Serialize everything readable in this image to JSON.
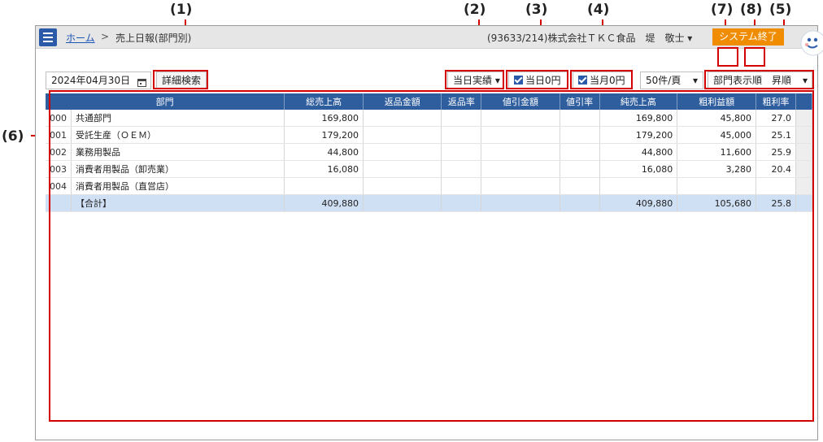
{
  "callouts": {
    "c1": "(1)",
    "c2": "(2)",
    "c3": "(3)",
    "c4": "(4)",
    "c7": "(7)",
    "c8": "(8)",
    "c5": "(5)",
    "c6": "(6)"
  },
  "header": {
    "home_link": "ホーム",
    "separator": ">",
    "page_title": "売上日報(部門別)",
    "user_info": "(93633/214)株式会社ＴＫＣ食品　堤　敬士 ▾",
    "exit_label": "システム終了"
  },
  "toolbar": {
    "date_value": "2024年04月30日",
    "calendar_icon": "calendar-icon",
    "detail_search_label": "詳細検索",
    "period_select": "当日実績 ▾",
    "day_zero_label": "当日0円",
    "month_zero_label": "当月0円",
    "per_page_select": "50件/頁",
    "sort_select": "部門表示順　昇順"
  },
  "table": {
    "columns": [
      "部門",
      "総売上高",
      "返品金額",
      "返品率",
      "値引金額",
      "値引率",
      "純売上高",
      "粗利益額",
      "粗利率"
    ],
    "rows": [
      {
        "code": "000",
        "name": "共通部門",
        "gross": "169,800",
        "ret": "",
        "ret_rate": "",
        "disc": "",
        "disc_rate": "",
        "net": "169,800",
        "profit": "45,800",
        "profit_rate": "27.0"
      },
      {
        "code": "001",
        "name": "受託生産（ＯＥＭ）",
        "gross": "179,200",
        "ret": "",
        "ret_rate": "",
        "disc": "",
        "disc_rate": "",
        "net": "179,200",
        "profit": "45,000",
        "profit_rate": "25.1"
      },
      {
        "code": "002",
        "name": "業務用製品",
        "gross": "44,800",
        "ret": "",
        "ret_rate": "",
        "disc": "",
        "disc_rate": "",
        "net": "44,800",
        "profit": "11,600",
        "profit_rate": "25.9"
      },
      {
        "code": "003",
        "name": "消費者用製品（卸売業）",
        "gross": "16,080",
        "ret": "",
        "ret_rate": "",
        "disc": "",
        "disc_rate": "",
        "net": "16,080",
        "profit": "3,280",
        "profit_rate": "20.4"
      },
      {
        "code": "004",
        "name": "消費者用製品（直営店）",
        "gross": "",
        "ret": "",
        "ret_rate": "",
        "disc": "",
        "disc_rate": "",
        "net": "",
        "profit": "",
        "profit_rate": ""
      }
    ],
    "total": {
      "name": "【合計】",
      "gross": "409,880",
      "ret": "",
      "ret_rate": "",
      "disc": "",
      "disc_rate": "",
      "net": "409,880",
      "profit": "105,680",
      "profit_rate": "25.8"
    }
  },
  "colors": {
    "accent": "#2f5e9e",
    "exit": "#f08c00",
    "callout_red": "#d40000",
    "total_row": "#cfe0f4"
  }
}
